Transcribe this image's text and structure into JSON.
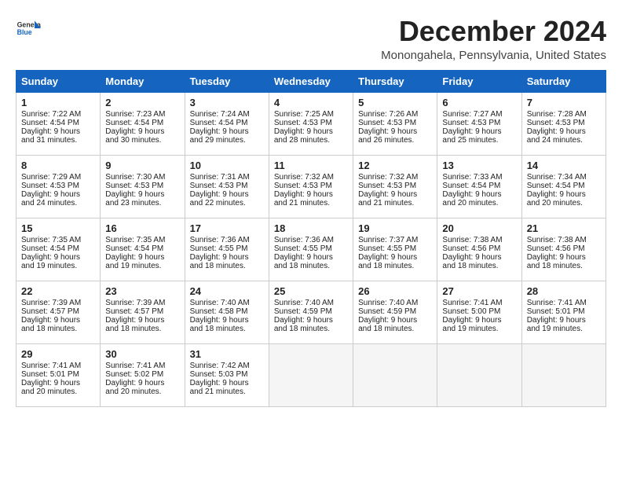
{
  "logo": {
    "line1": "General",
    "line2": "Blue"
  },
  "title": "December 2024",
  "location": "Monongahela, Pennsylvania, United States",
  "days_of_week": [
    "Sunday",
    "Monday",
    "Tuesday",
    "Wednesday",
    "Thursday",
    "Friday",
    "Saturday"
  ],
  "weeks": [
    [
      {
        "day": "1",
        "sunrise": "Sunrise: 7:22 AM",
        "sunset": "Sunset: 4:54 PM",
        "daylight": "Daylight: 9 hours and 31 minutes."
      },
      {
        "day": "2",
        "sunrise": "Sunrise: 7:23 AM",
        "sunset": "Sunset: 4:54 PM",
        "daylight": "Daylight: 9 hours and 30 minutes."
      },
      {
        "day": "3",
        "sunrise": "Sunrise: 7:24 AM",
        "sunset": "Sunset: 4:54 PM",
        "daylight": "Daylight: 9 hours and 29 minutes."
      },
      {
        "day": "4",
        "sunrise": "Sunrise: 7:25 AM",
        "sunset": "Sunset: 4:53 PM",
        "daylight": "Daylight: 9 hours and 28 minutes."
      },
      {
        "day": "5",
        "sunrise": "Sunrise: 7:26 AM",
        "sunset": "Sunset: 4:53 PM",
        "daylight": "Daylight: 9 hours and 26 minutes."
      },
      {
        "day": "6",
        "sunrise": "Sunrise: 7:27 AM",
        "sunset": "Sunset: 4:53 PM",
        "daylight": "Daylight: 9 hours and 25 minutes."
      },
      {
        "day": "7",
        "sunrise": "Sunrise: 7:28 AM",
        "sunset": "Sunset: 4:53 PM",
        "daylight": "Daylight: 9 hours and 24 minutes."
      }
    ],
    [
      {
        "day": "8",
        "sunrise": "Sunrise: 7:29 AM",
        "sunset": "Sunset: 4:53 PM",
        "daylight": "Daylight: 9 hours and 24 minutes."
      },
      {
        "day": "9",
        "sunrise": "Sunrise: 7:30 AM",
        "sunset": "Sunset: 4:53 PM",
        "daylight": "Daylight: 9 hours and 23 minutes."
      },
      {
        "day": "10",
        "sunrise": "Sunrise: 7:31 AM",
        "sunset": "Sunset: 4:53 PM",
        "daylight": "Daylight: 9 hours and 22 minutes."
      },
      {
        "day": "11",
        "sunrise": "Sunrise: 7:32 AM",
        "sunset": "Sunset: 4:53 PM",
        "daylight": "Daylight: 9 hours and 21 minutes."
      },
      {
        "day": "12",
        "sunrise": "Sunrise: 7:32 AM",
        "sunset": "Sunset: 4:53 PM",
        "daylight": "Daylight: 9 hours and 21 minutes."
      },
      {
        "day": "13",
        "sunrise": "Sunrise: 7:33 AM",
        "sunset": "Sunset: 4:54 PM",
        "daylight": "Daylight: 9 hours and 20 minutes."
      },
      {
        "day": "14",
        "sunrise": "Sunrise: 7:34 AM",
        "sunset": "Sunset: 4:54 PM",
        "daylight": "Daylight: 9 hours and 20 minutes."
      }
    ],
    [
      {
        "day": "15",
        "sunrise": "Sunrise: 7:35 AM",
        "sunset": "Sunset: 4:54 PM",
        "daylight": "Daylight: 9 hours and 19 minutes."
      },
      {
        "day": "16",
        "sunrise": "Sunrise: 7:35 AM",
        "sunset": "Sunset: 4:54 PM",
        "daylight": "Daylight: 9 hours and 19 minutes."
      },
      {
        "day": "17",
        "sunrise": "Sunrise: 7:36 AM",
        "sunset": "Sunset: 4:55 PM",
        "daylight": "Daylight: 9 hours and 18 minutes."
      },
      {
        "day": "18",
        "sunrise": "Sunrise: 7:36 AM",
        "sunset": "Sunset: 4:55 PM",
        "daylight": "Daylight: 9 hours and 18 minutes."
      },
      {
        "day": "19",
        "sunrise": "Sunrise: 7:37 AM",
        "sunset": "Sunset: 4:55 PM",
        "daylight": "Daylight: 9 hours and 18 minutes."
      },
      {
        "day": "20",
        "sunrise": "Sunrise: 7:38 AM",
        "sunset": "Sunset: 4:56 PM",
        "daylight": "Daylight: 9 hours and 18 minutes."
      },
      {
        "day": "21",
        "sunrise": "Sunrise: 7:38 AM",
        "sunset": "Sunset: 4:56 PM",
        "daylight": "Daylight: 9 hours and 18 minutes."
      }
    ],
    [
      {
        "day": "22",
        "sunrise": "Sunrise: 7:39 AM",
        "sunset": "Sunset: 4:57 PM",
        "daylight": "Daylight: 9 hours and 18 minutes."
      },
      {
        "day": "23",
        "sunrise": "Sunrise: 7:39 AM",
        "sunset": "Sunset: 4:57 PM",
        "daylight": "Daylight: 9 hours and 18 minutes."
      },
      {
        "day": "24",
        "sunrise": "Sunrise: 7:40 AM",
        "sunset": "Sunset: 4:58 PM",
        "daylight": "Daylight: 9 hours and 18 minutes."
      },
      {
        "day": "25",
        "sunrise": "Sunrise: 7:40 AM",
        "sunset": "Sunset: 4:59 PM",
        "daylight": "Daylight: 9 hours and 18 minutes."
      },
      {
        "day": "26",
        "sunrise": "Sunrise: 7:40 AM",
        "sunset": "Sunset: 4:59 PM",
        "daylight": "Daylight: 9 hours and 18 minutes."
      },
      {
        "day": "27",
        "sunrise": "Sunrise: 7:41 AM",
        "sunset": "Sunset: 5:00 PM",
        "daylight": "Daylight: 9 hours and 19 minutes."
      },
      {
        "day": "28",
        "sunrise": "Sunrise: 7:41 AM",
        "sunset": "Sunset: 5:01 PM",
        "daylight": "Daylight: 9 hours and 19 minutes."
      }
    ],
    [
      {
        "day": "29",
        "sunrise": "Sunrise: 7:41 AM",
        "sunset": "Sunset: 5:01 PM",
        "daylight": "Daylight: 9 hours and 20 minutes."
      },
      {
        "day": "30",
        "sunrise": "Sunrise: 7:41 AM",
        "sunset": "Sunset: 5:02 PM",
        "daylight": "Daylight: 9 hours and 20 minutes."
      },
      {
        "day": "31",
        "sunrise": "Sunrise: 7:42 AM",
        "sunset": "Sunset: 5:03 PM",
        "daylight": "Daylight: 9 hours and 21 minutes."
      },
      null,
      null,
      null,
      null
    ]
  ]
}
